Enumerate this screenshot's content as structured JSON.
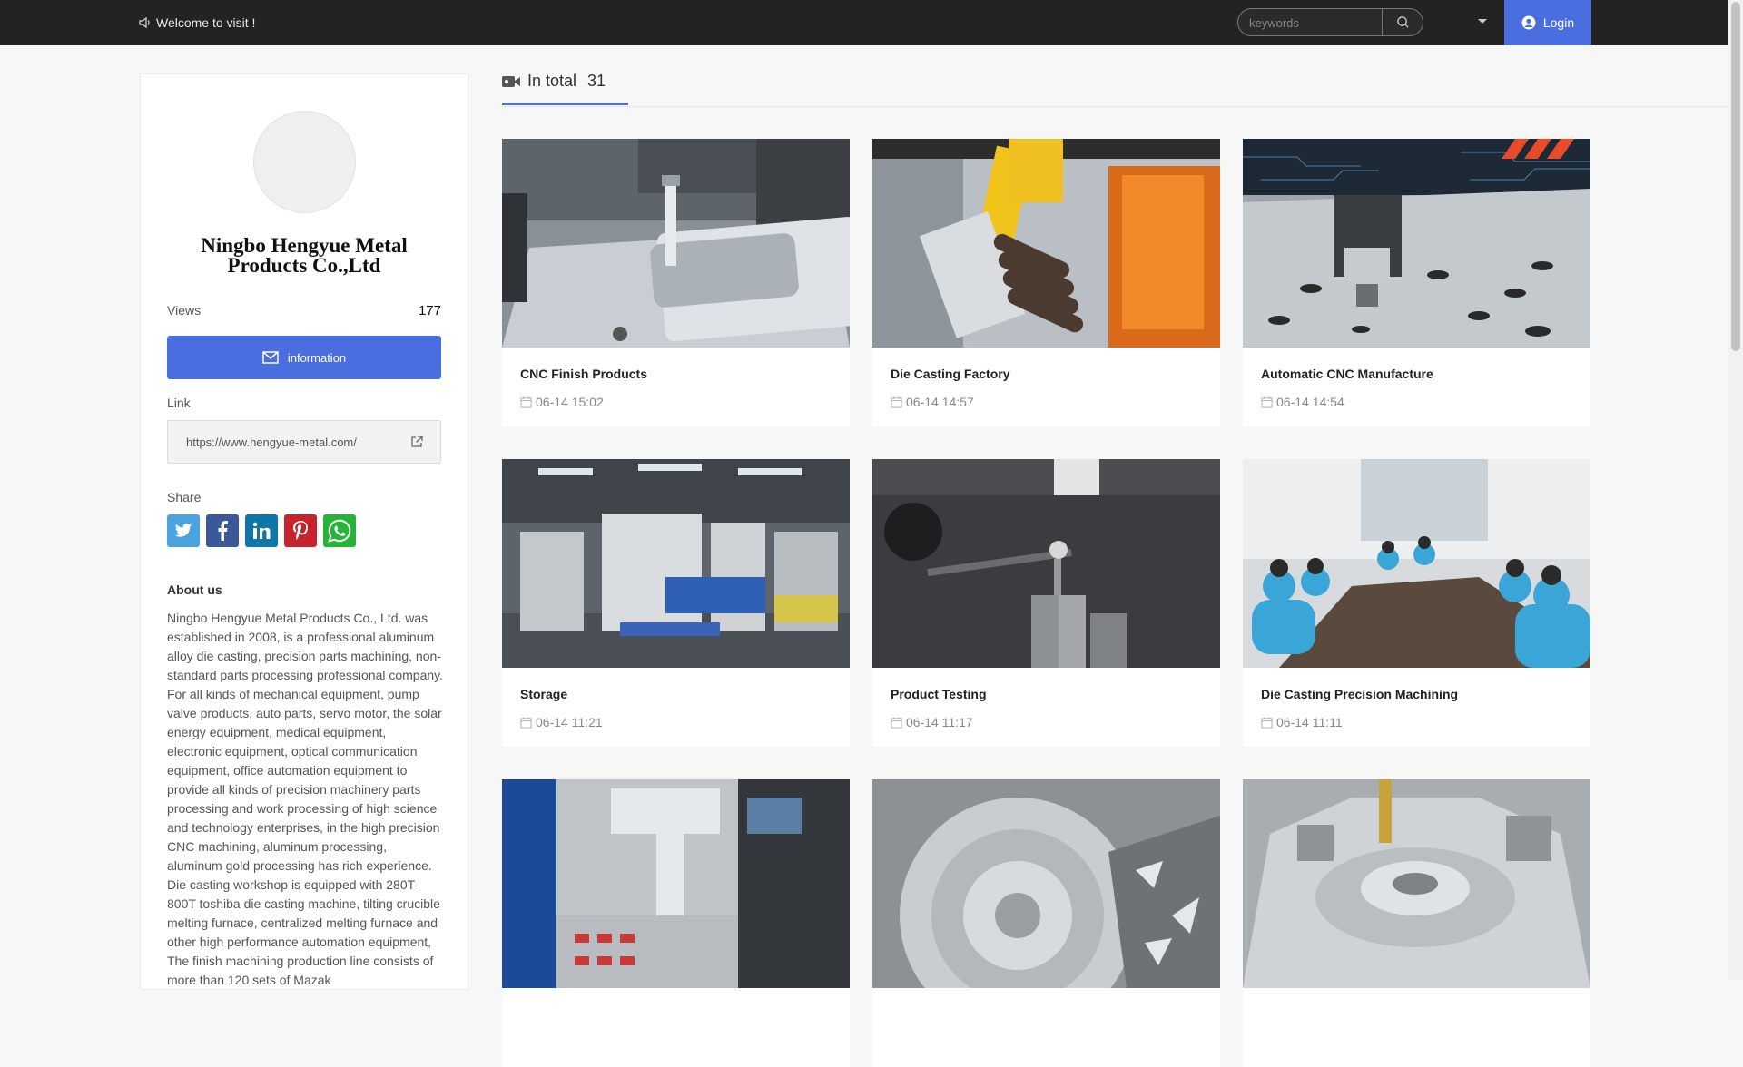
{
  "header": {
    "welcome": "Welcome to visit !",
    "search_placeholder": "keywords",
    "login_label": "Login"
  },
  "profile": {
    "company_name": "Ningbo Hengyue Metal Products Co.,Ltd",
    "views_label": "Views",
    "views_count": "177",
    "info_button": "information",
    "link_label": "Link",
    "link_url": "https://www.hengyue-metal.com/",
    "share_label": "Share",
    "share": [
      {
        "name": "twitter",
        "color": "#4aa3df"
      },
      {
        "name": "facebook",
        "color": "#3b5998"
      },
      {
        "name": "linkedin",
        "color": "#0e76a8"
      },
      {
        "name": "pinterest",
        "color": "#c8232c"
      },
      {
        "name": "whatsapp",
        "color": "#25b338"
      }
    ],
    "about_title": "About us",
    "about_text": "Ningbo Hengyue Metal Products Co., Ltd. was established in 2008, is a professional aluminum alloy die casting, precision parts machining, non-standard parts processing professional company. For all kinds of mechanical equipment, pump valve products, auto parts, servo motor, the solar energy equipment, medical equipment, electronic equipment, optical communication equipment, office automation equipment to provide all kinds of precision machinery parts processing and work processing of high science and technology enterprises, in the high precision CNC machining, aluminum processing, aluminum gold processing has rich experience. Die casting workshop is equipped with 280T-800T toshiba die casting machine, tilting crucible melting furnace, centralized melting furnace and other high performance automation equipment, The finish machining production line consists of more than 120 sets of Mazak"
  },
  "main": {
    "tab_label": "In total",
    "tab_count": "31",
    "accent": "#4a6ee0",
    "videos": [
      {
        "title": "CNC Finish Products",
        "date": "06-14 15:02"
      },
      {
        "title": "Die Casting Factory",
        "date": "06-14 14:57"
      },
      {
        "title": "Automatic CNC Manufacture",
        "date": "06-14 14:54"
      },
      {
        "title": "Storage",
        "date": "06-14 11:21"
      },
      {
        "title": "Product Testing",
        "date": "06-14 11:17"
      },
      {
        "title": "Die Casting Precision Machining",
        "date": "06-14 11:11"
      },
      {
        "title": "",
        "date": ""
      },
      {
        "title": "",
        "date": ""
      },
      {
        "title": "",
        "date": ""
      }
    ]
  }
}
